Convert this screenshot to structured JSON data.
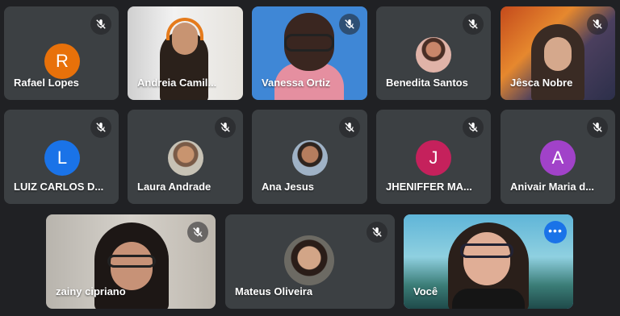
{
  "colors": {
    "background": "#202124",
    "tile": "#3c4043",
    "active_outline": "#8ab4f8",
    "avatar_orange": "#e8710a",
    "avatar_blue": "#1a73e8",
    "avatar_magenta": "#c5215c",
    "avatar_purple": "#a142c9"
  },
  "participants": [
    {
      "name": "Rafael Lopes",
      "type": "letter",
      "letter": "R",
      "muted": true
    },
    {
      "name": "Andreia Camil...",
      "type": "video",
      "muted": true
    },
    {
      "name": "Vanessa Ortiz",
      "type": "video",
      "muted": true
    },
    {
      "name": "Benedita Santos",
      "type": "photo",
      "muted": true
    },
    {
      "name": "Jêsca Nobre",
      "type": "video",
      "muted": true
    },
    {
      "name": "LUIZ CARLOS D...",
      "type": "letter",
      "letter": "L",
      "muted": true
    },
    {
      "name": "Laura Andrade",
      "type": "photo",
      "muted": true
    },
    {
      "name": "Ana Jesus",
      "type": "photo",
      "muted": true
    },
    {
      "name": "JHENIFFER MA...",
      "type": "letter",
      "letter": "J",
      "muted": true
    },
    {
      "name": "Anivair Maria d...",
      "type": "letter",
      "letter": "A",
      "muted": true
    },
    {
      "name": "zainy cipriano",
      "type": "video",
      "muted": true
    },
    {
      "name": "Mateus Oliveira",
      "type": "photo",
      "muted": true
    },
    {
      "name": "Você",
      "type": "video",
      "muted": false,
      "self": true
    }
  ],
  "icons": {
    "mic_off": "mic-off-icon",
    "more": "more-options-icon"
  }
}
